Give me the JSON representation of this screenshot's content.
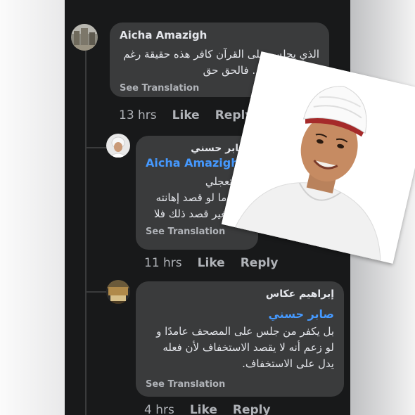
{
  "comments": [
    {
      "author": "Aicha Amazigh",
      "text": "الذي يجلس على القرآن كافر هذه حقيقة رغم\nكرهي للأحباش. فالحق حق",
      "see_translation": "See Translation",
      "time": "13 hrs",
      "like": "Like",
      "reply": "Reply"
    },
    {
      "author": "صابر حسني",
      "mention": "Aicha Amazigh",
      "text": ".لا تتعجلي\n!هذا ما لو قصد إهانته\n!أما بغير قصد ذلك فلا",
      "see_translation": "See Translation",
      "time": "11 hrs",
      "like": "Like",
      "reply": "Reply"
    },
    {
      "author": "إبراهيم عكاس",
      "mention": "صابر حسني",
      "text": "بل يكفر من جلس على المصحف عامدًا و\nلو زعم أنه لا يقصد الاستخفاف لأن فعله\nيدل على الاستخفاف.",
      "see_translation": "See Translation",
      "time": "4 hrs",
      "like": "Like",
      "reply": "Reply"
    }
  ],
  "colors": {
    "panel_bg": "#18191a",
    "bubble_bg": "#3a3b3c",
    "text": "#e4e6eb",
    "muted": "#b0b3b8",
    "mention": "#4599ff"
  }
}
